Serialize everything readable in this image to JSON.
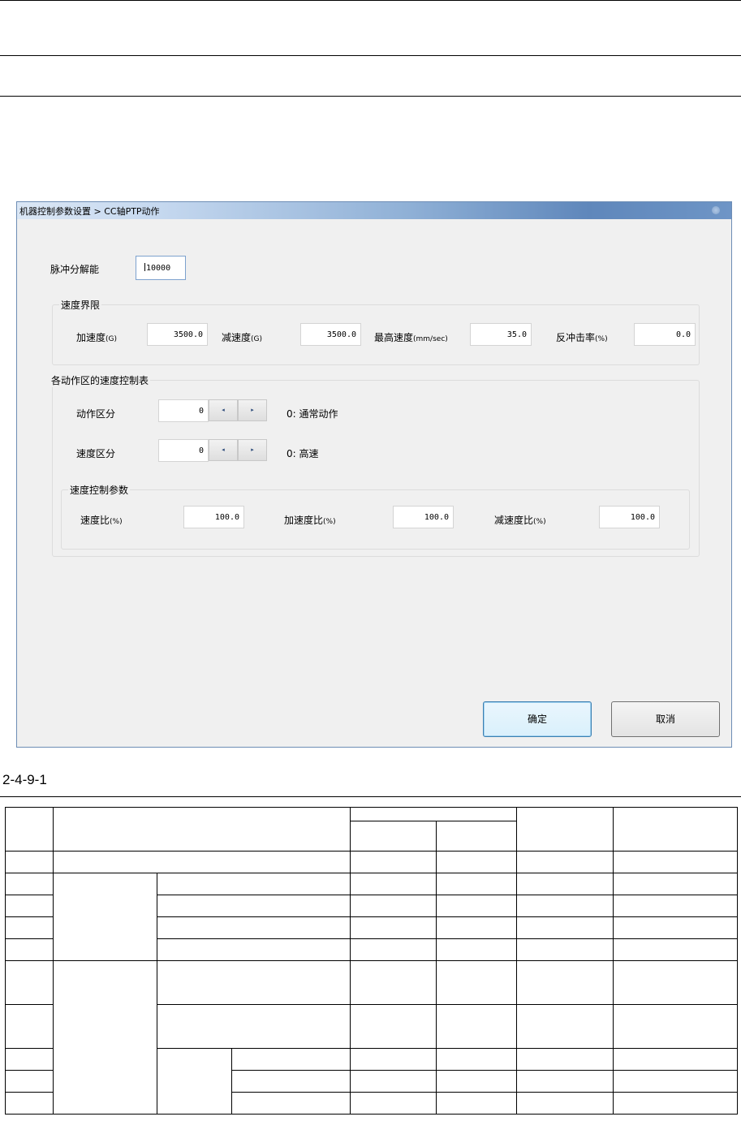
{
  "window": {
    "title": "机器控制参数设置 > CC轴PTP动作"
  },
  "pulse_resolution": {
    "label": "脉冲分解能",
    "value": "10000"
  },
  "speed_limit": {
    "group_title": "速度界限",
    "accel_label": "加速度",
    "accel_unit": "(G)",
    "accel_value": "3500.0",
    "decel_label": "减速度",
    "decel_unit": "(G)",
    "decel_value": "3500.0",
    "max_speed_label": "最高速度",
    "max_speed_unit": "(mm/sec)",
    "max_speed_value": "35.0",
    "recoil_label": "反冲击率",
    "recoil_unit": "(%)",
    "recoil_value": "0.0"
  },
  "speed_table": {
    "group_title": "各动作区的速度控制表",
    "action_zone_label": "动作区分",
    "action_zone_value": "0",
    "action_zone_desc": "0: 通常动作",
    "speed_zone_label": "速度区分",
    "speed_zone_value": "0",
    "speed_zone_desc": "0: 高速",
    "spin_left": "◂",
    "spin_right": "▸",
    "params": {
      "group_title": "速度控制参数",
      "speed_ratio_label": "速度比",
      "speed_ratio_unit": "(%)",
      "speed_ratio_value": "100.0",
      "accel_ratio_label": "加速度比",
      "accel_ratio_unit": "(%)",
      "accel_ratio_value": "100.0",
      "decel_ratio_label": "减速度比",
      "decel_ratio_unit": "(%)",
      "decel_ratio_value": "100.0"
    }
  },
  "buttons": {
    "ok": "确定",
    "cancel": "取消"
  },
  "caption": "2-4-9-1"
}
